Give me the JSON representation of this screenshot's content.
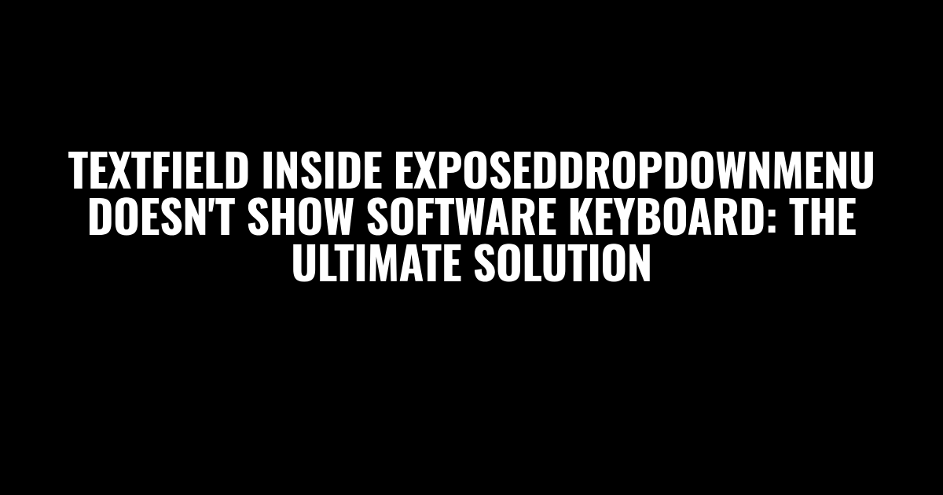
{
  "title": "TextField inside ExposedDropdownMenu doesn't show software keyboard: The Ultimate Solution"
}
